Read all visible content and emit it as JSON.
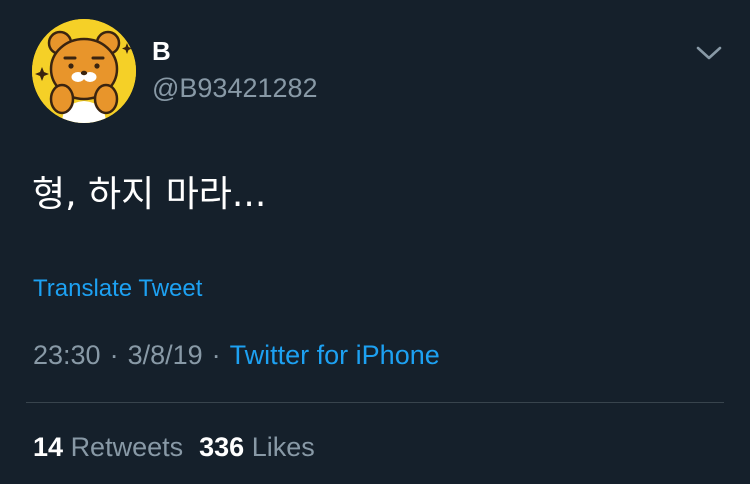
{
  "tweet": {
    "display_name": "B",
    "handle": "@B93421282",
    "text": "형, 하지 마라...",
    "translate_label": "Translate Tweet",
    "time": "23:30",
    "date": "3/8/19",
    "separator": "·",
    "source": "Twitter for iPhone"
  },
  "stats": {
    "retweets_count": "14",
    "retweets_label": "Retweets",
    "likes_count": "336",
    "likes_label": "Likes"
  },
  "icons": {
    "avatar": "bear-character-avatar",
    "menu": "chevron-down-icon"
  },
  "colors": {
    "background": "#15202b",
    "text": "#ffffff",
    "secondary_text": "#8899a6",
    "accent": "#1da1f2",
    "divider": "#38444d",
    "avatar_background": "#f5d027"
  }
}
